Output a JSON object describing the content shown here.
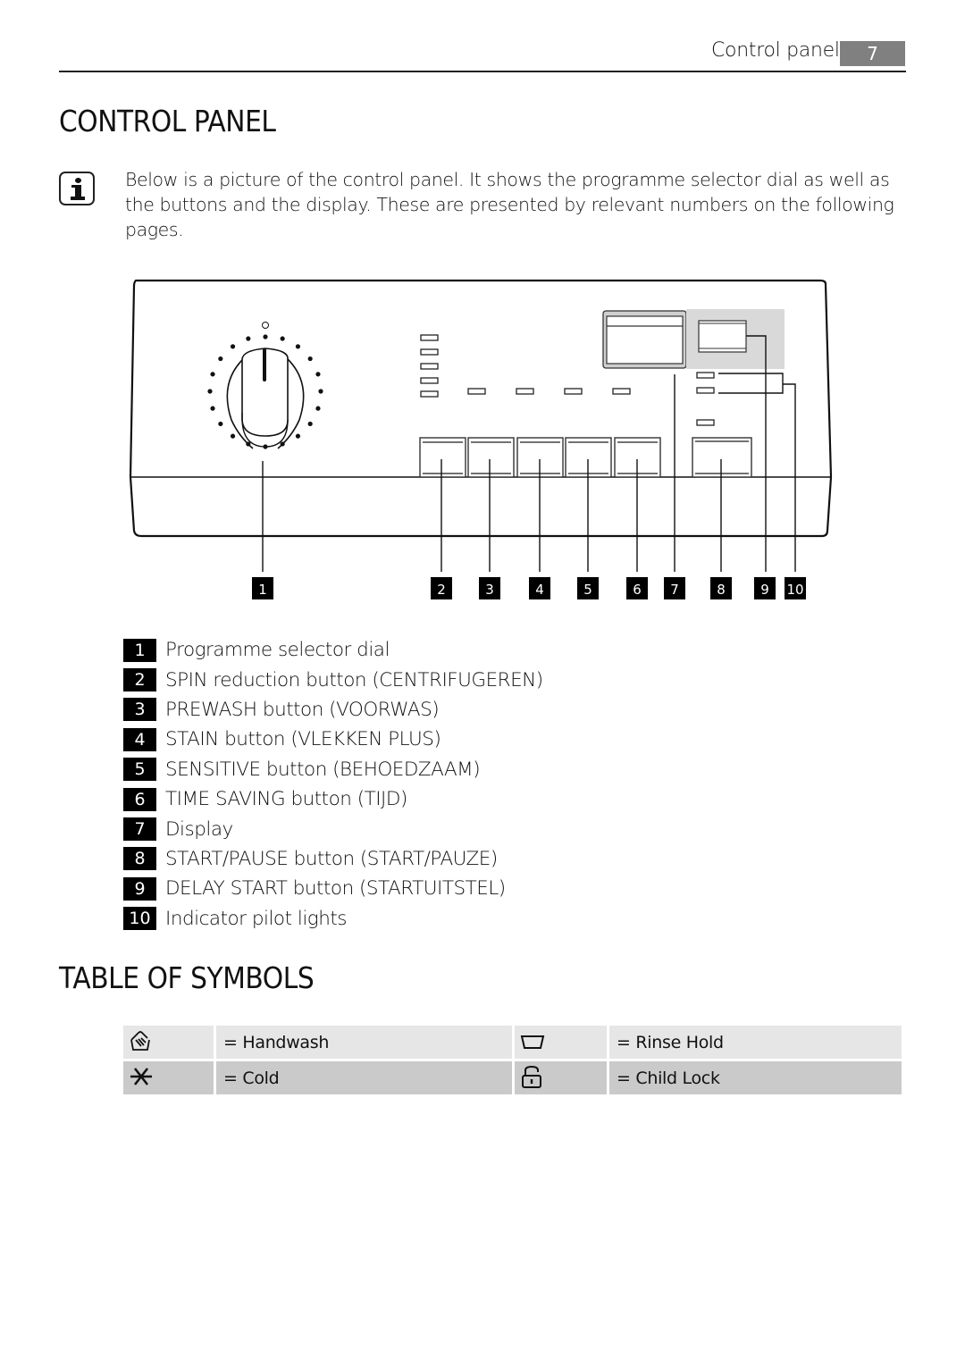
{
  "header": {
    "section_title": "Control panel",
    "page_number": "7"
  },
  "control_panel": {
    "heading": "CONTROL PANEL",
    "info_icon": "info-icon",
    "intro": "Below is a picture of the control panel. It shows the programme selector dial as well as the buttons and the display. These are presented by relevant numbers on the following pages.",
    "callouts": [
      "1",
      "2",
      "3",
      "4",
      "5",
      "6",
      "7",
      "8",
      "9",
      "10"
    ],
    "legend": [
      {
        "num": "1",
        "label": "Programme selector dial"
      },
      {
        "num": "2",
        "label": "SPIN reduction button (CENTRIFUGEREN)"
      },
      {
        "num": "3",
        "label": "PREWASH button (VOORWAS)"
      },
      {
        "num": "4",
        "label": "STAIN button (VLEKKEN PLUS)"
      },
      {
        "num": "5",
        "label": "SENSITIVE button (BEHOEDZAAM)"
      },
      {
        "num": "6",
        "label": "TIME SAVING button (TIJD)"
      },
      {
        "num": "7",
        "label": "Display"
      },
      {
        "num": "8",
        "label": "START/PAUSE button (START/PAUZE)"
      },
      {
        "num": "9",
        "label": "DELAY START button (STARTUITSTEL)"
      },
      {
        "num": "10",
        "label": "Indicator pilot lights"
      }
    ]
  },
  "symbols": {
    "heading": "TABLE OF SYMBOLS",
    "rows": [
      [
        {
          "icon": "handwash-icon",
          "label": "= Handwash"
        },
        {
          "icon": "rinse-hold-icon",
          "label": "= Rinse Hold"
        }
      ],
      [
        {
          "icon": "cold-icon",
          "label": "= Cold"
        },
        {
          "icon": "child-lock-icon",
          "label": "= Child Lock"
        }
      ]
    ]
  }
}
